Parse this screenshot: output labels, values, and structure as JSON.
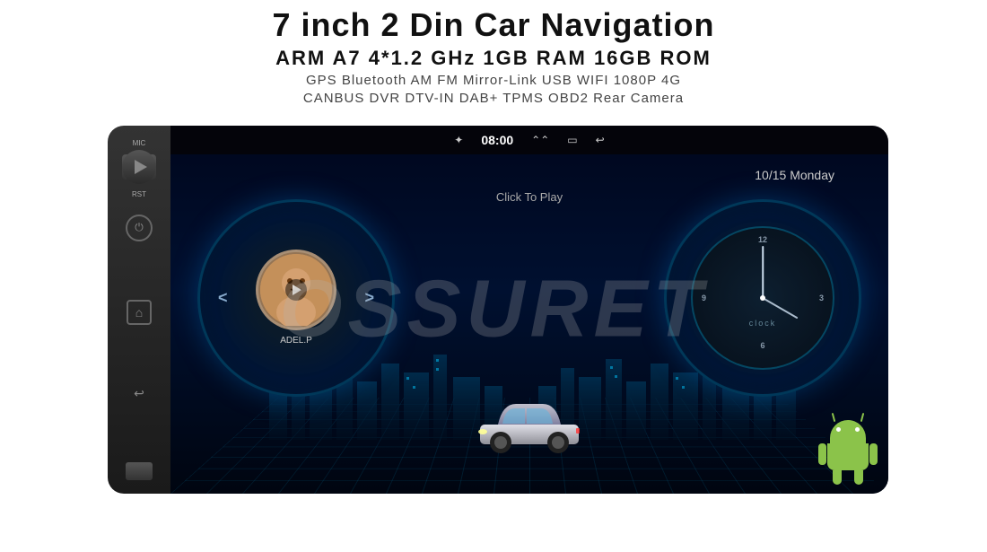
{
  "header": {
    "title": "7 inch 2 Din Car Navigation",
    "specs": "ARM A7 4*1.2 GHz    1GB RAM    16GB ROM",
    "features_line1": "GPS  Bluetooth  AM  FM  Mirror-Link  USB  WIFI  1080P  4G",
    "features_line2": "CANBUS   DVR   DTV-IN   DAB+   TPMS   OBD2   Rear Camera"
  },
  "watermark": "OSSURET",
  "status_bar": {
    "bluetooth_icon": "✦",
    "time": "08:00",
    "signal_icon": "⌃⌃",
    "menu_icon": "▭",
    "back_icon": "↩"
  },
  "screen": {
    "click_to_play": "Click To Play",
    "music_title": "ADEL.P",
    "prev_label": "<",
    "next_label": ">",
    "date": "10/15 Monday",
    "clock_label": "clock"
  },
  "left_panel": {
    "mic_label": "MIC",
    "rst_label": "RST",
    "play_btn": "▶",
    "power_icon": "⏻",
    "home_icon": "⌂",
    "back_icon": "↩"
  }
}
